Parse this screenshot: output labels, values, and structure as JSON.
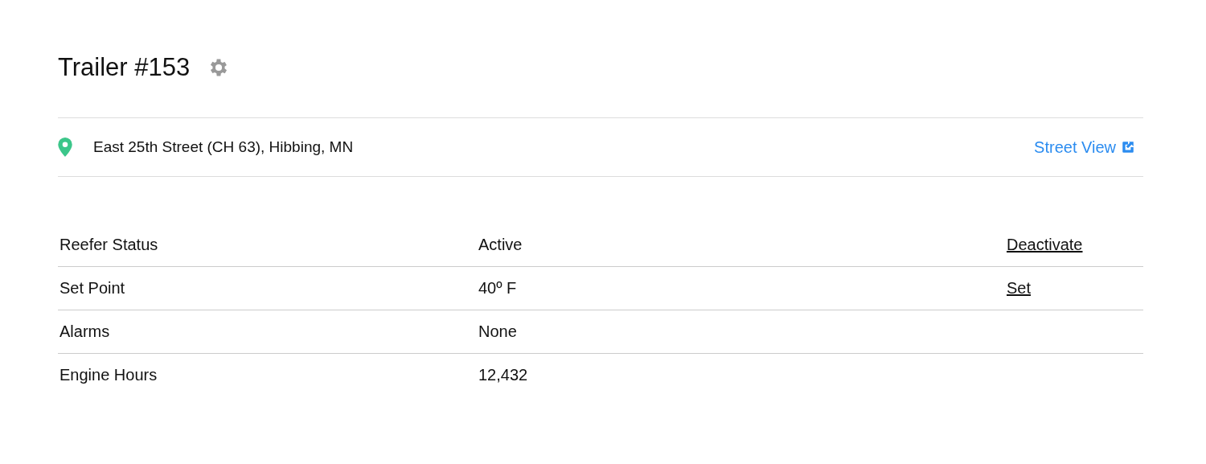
{
  "title": "Trailer #153",
  "location": {
    "address": "East 25th Street (CH 63), Hibbing, MN",
    "link": "Street View"
  },
  "rows": [
    {
      "label": "Reefer Status",
      "value": "Active",
      "action": "Deactivate"
    },
    {
      "label": "Set Point",
      "value": "40º F",
      "action": "Set"
    },
    {
      "label": "Alarms",
      "value": "None"
    },
    {
      "label": "Engine Hours",
      "value": "12,432"
    }
  ]
}
